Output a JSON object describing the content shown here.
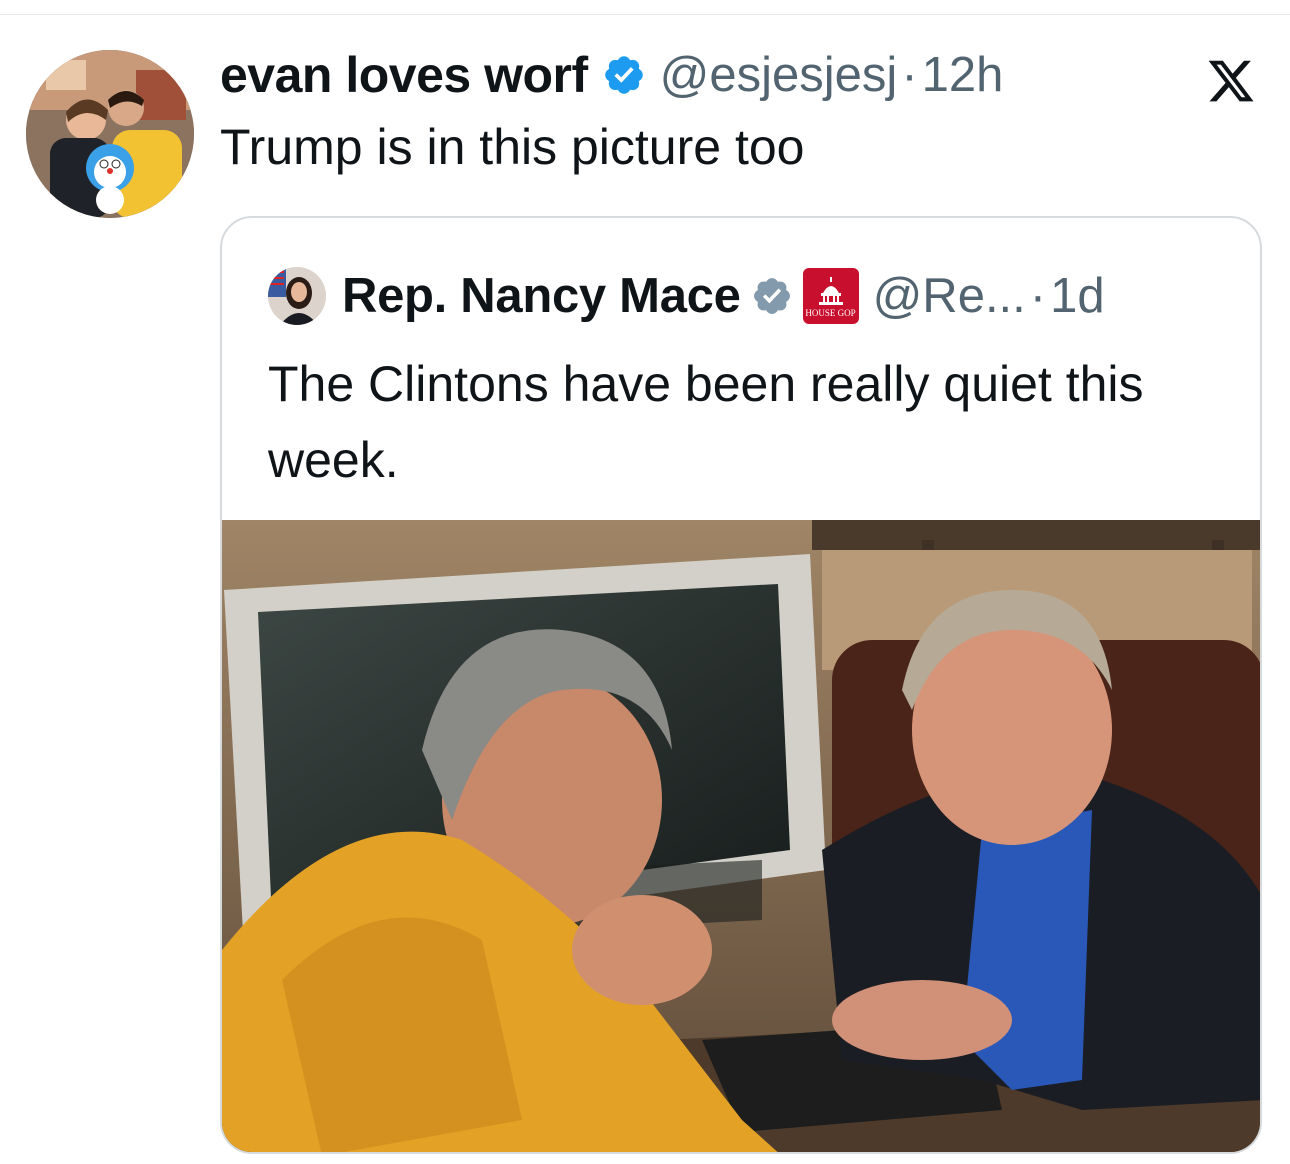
{
  "tweet": {
    "display_name": "evan loves worf",
    "handle": "@esjesjesj",
    "separator": "·",
    "time": "12h",
    "text": "Trump is in this picture too",
    "avatar_icon": "profile-photo",
    "verified_icon": "verified-badge-icon"
  },
  "quoted_tweet": {
    "display_name": "Rep. Nancy Mace",
    "handle": "@Re...",
    "separator": "·",
    "time": "1d",
    "text": "The Clintons have been really quiet this week.",
    "affiliation_badge_text": "HOUSE GOP",
    "verified_icon": "verified-badge-icon",
    "media_description_icon": "photo"
  },
  "app_icon": "x-logo-icon",
  "colors": {
    "verified_blue": "#1d9bf0",
    "verified_gray": "#829aab",
    "secondary_text": "#536471",
    "border": "#d6dadd",
    "gop_red": "#c8102e"
  }
}
